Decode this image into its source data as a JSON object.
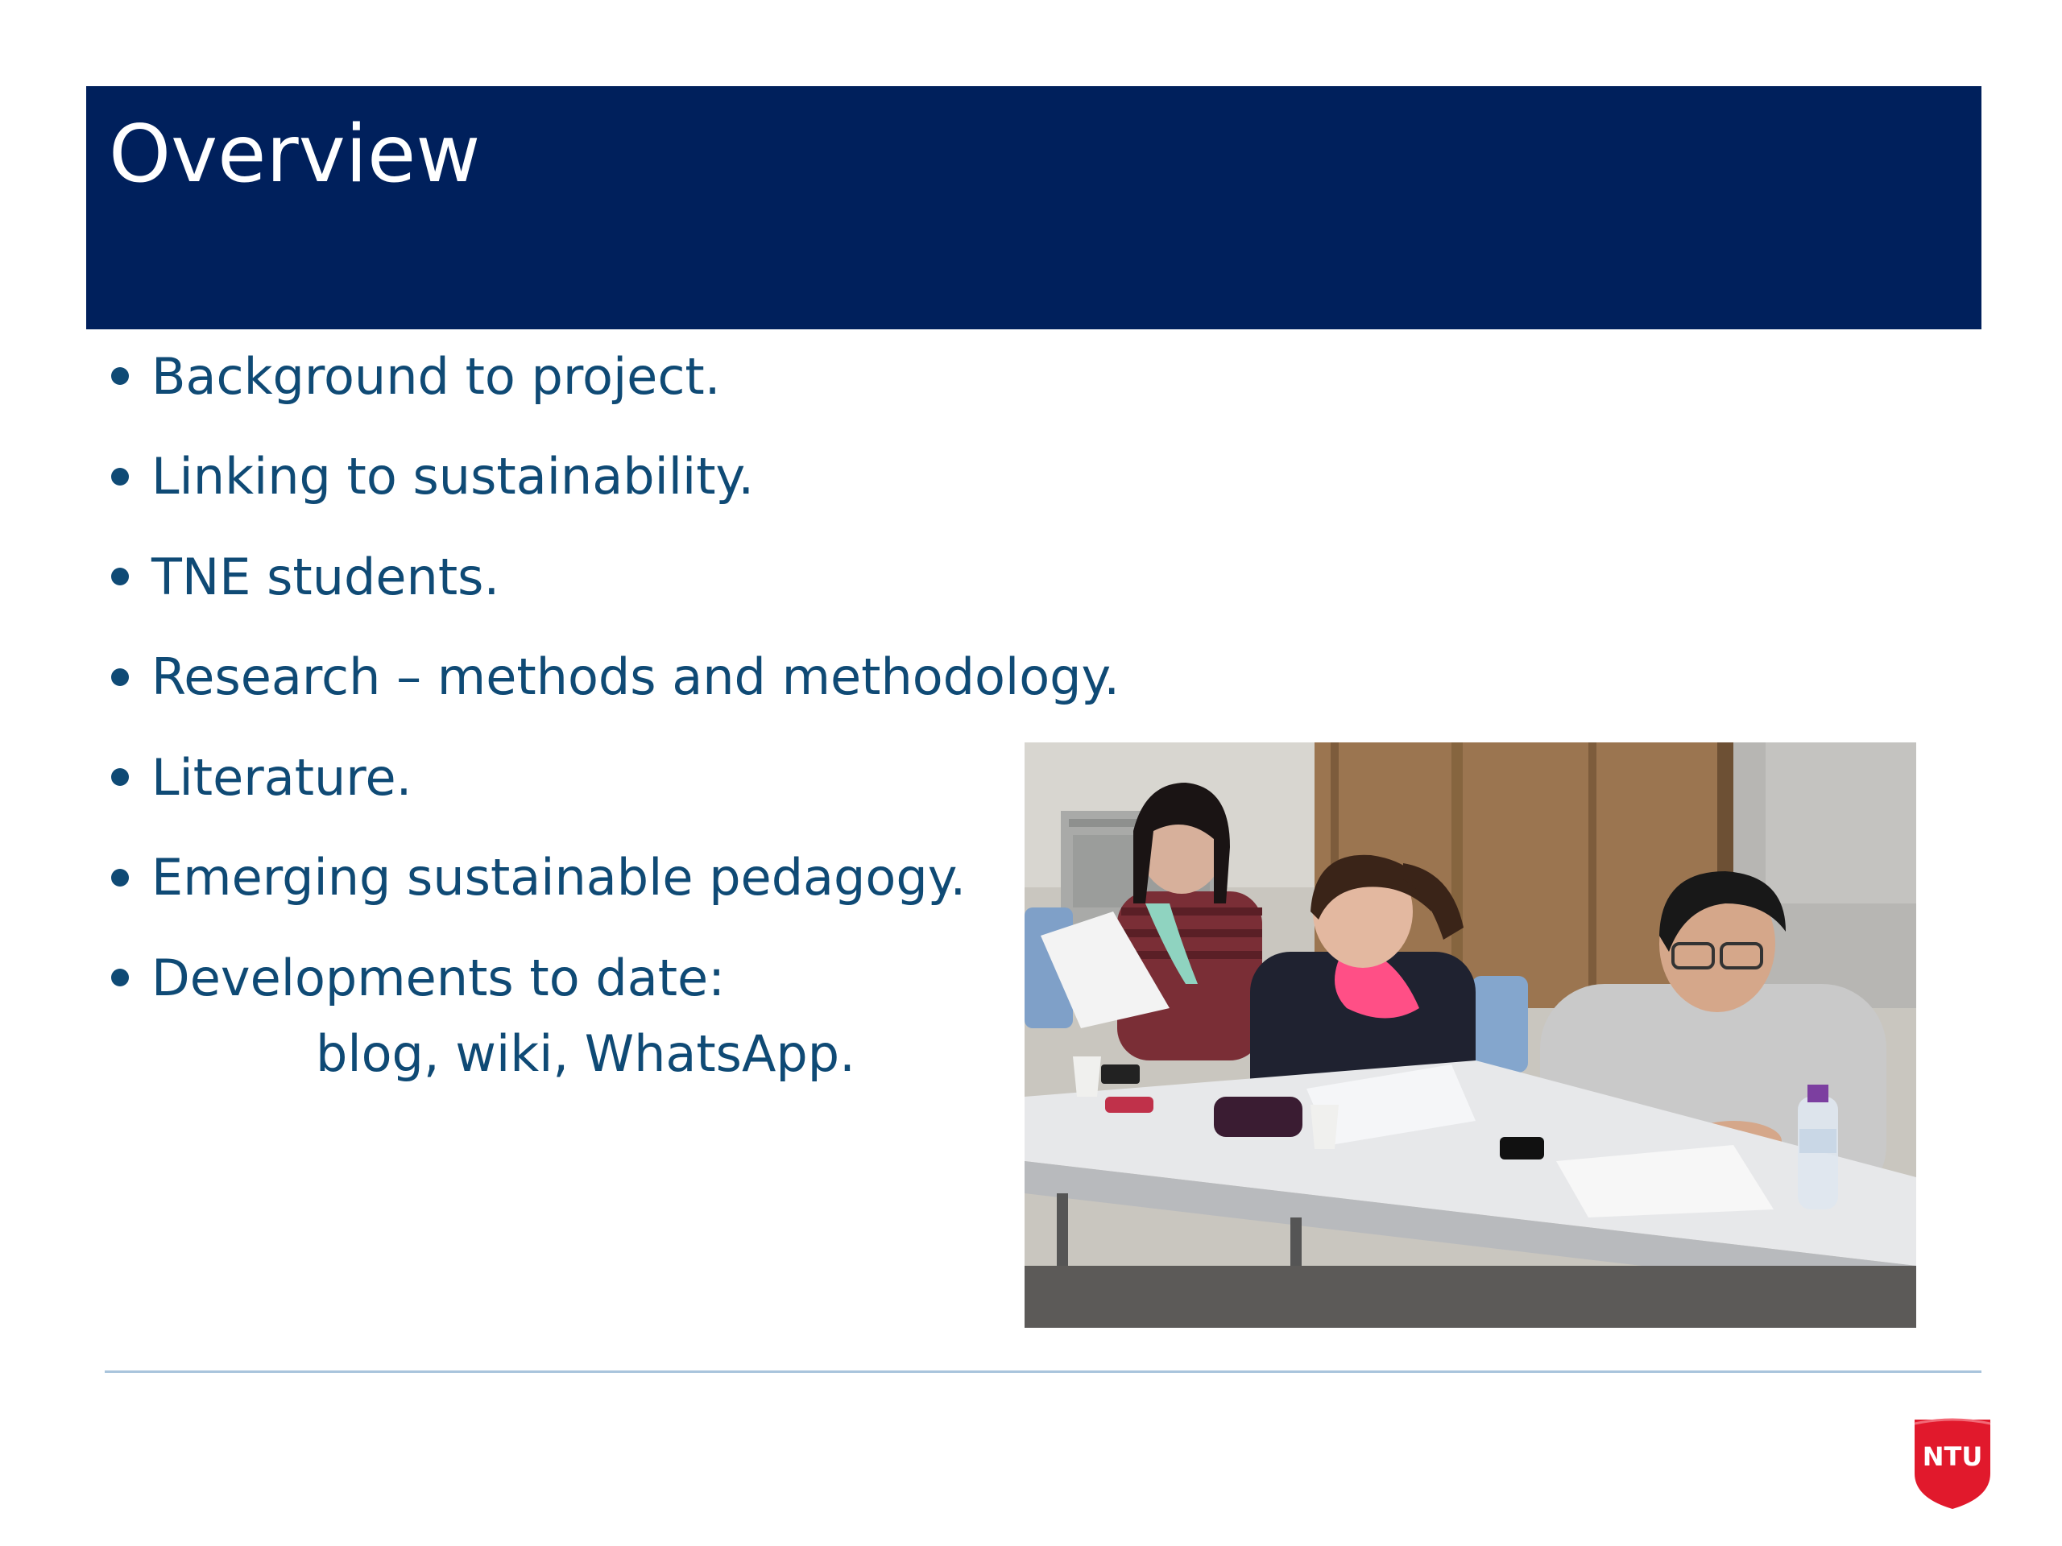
{
  "slide": {
    "title": "Overview",
    "bullets": [
      "Background to project.",
      "Linking to sustainability.",
      "TNE students.",
      "Research – methods and methodology.",
      "Literature.",
      "Emerging sustainable pedagogy.",
      "Developments to date:"
    ],
    "sub_line": "blog, wiki, WhatsApp."
  },
  "logo": {
    "text": "NTU",
    "color": "#e1192c"
  },
  "colors": {
    "title_bar": "#00205c",
    "title_text": "#ffffff",
    "body_text": "#0f4a75",
    "rule": "#a9c4dc"
  }
}
